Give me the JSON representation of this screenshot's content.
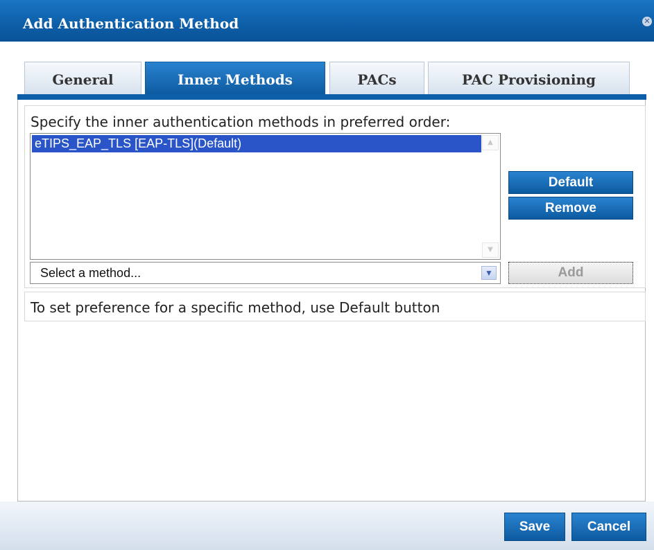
{
  "dialog": {
    "title": "Add Authentication Method",
    "close_icon": "close-icon"
  },
  "tabs": [
    {
      "label": "General",
      "active": false
    },
    {
      "label": "Inner Methods",
      "active": true
    },
    {
      "label": "PACs",
      "active": false
    },
    {
      "label": "PAC Provisioning",
      "active": false
    }
  ],
  "inner_methods": {
    "instruction": "Specify the inner authentication methods in preferred order:",
    "methods": [
      "eTIPS_EAP_TLS [EAP-TLS](Default)"
    ],
    "selected_method_index": 0,
    "default_button": "Default",
    "remove_button": "Remove",
    "select_placeholder": "Select a method...",
    "add_button": "Add",
    "note": "To set preference for a specific method, use Default button"
  },
  "footer": {
    "save_button": "Save",
    "cancel_button": "Cancel"
  },
  "colors": {
    "accent": "#0d5ea8",
    "selection": "#2a55c8"
  }
}
